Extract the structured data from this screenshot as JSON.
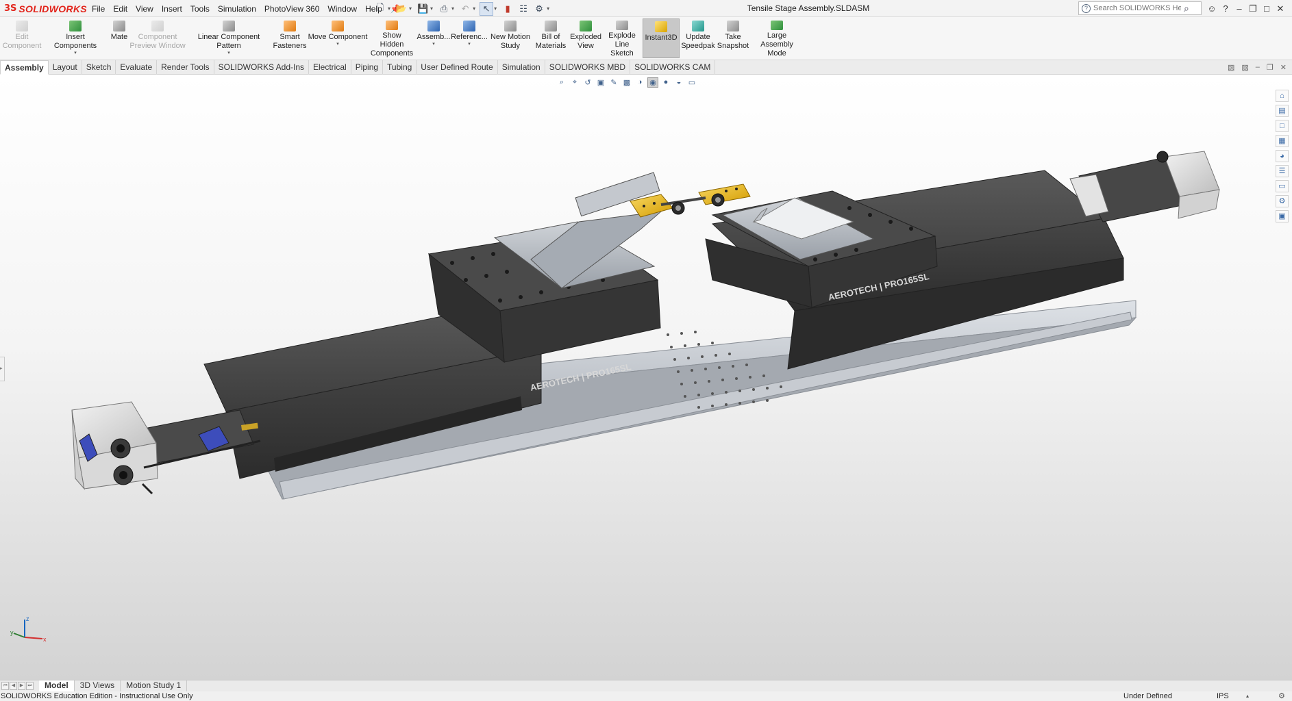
{
  "app": {
    "brand_ds": "3S",
    "brand_name": "SOLIDWORKS",
    "document_title": "Tensile Stage Assembly.SLDASM"
  },
  "menu": {
    "items": [
      "File",
      "Edit",
      "View",
      "Insert",
      "Tools",
      "Simulation",
      "PhotoView 360",
      "Window",
      "Help"
    ]
  },
  "search": {
    "placeholder": "Search SOLIDWORKS Help"
  },
  "ribbon": {
    "edit_component": {
      "line1": "Edit",
      "line2": "Component"
    },
    "insert_components": {
      "line1": "Insert Components"
    },
    "mate": {
      "line1": "Mate"
    },
    "component_preview": {
      "line1": "Component",
      "line2": "Preview Window"
    },
    "linear_pattern": {
      "line1": "Linear Component Pattern"
    },
    "smart_fasteners": {
      "line1": "Smart",
      "line2": "Fasteners"
    },
    "move_component": {
      "line1": "Move Component"
    },
    "show_hidden": {
      "line1": "Show Hidden",
      "line2": "Components"
    },
    "assembly_features": {
      "line1": "Assemb..."
    },
    "reference_geometry": {
      "line1": "Referenc..."
    },
    "new_motion_study": {
      "line1": "New Motion",
      "line2": "Study"
    },
    "bill_of_materials": {
      "line1": "Bill of",
      "line2": "Materials"
    },
    "exploded_view": {
      "line1": "Exploded",
      "line2": "View"
    },
    "explode_line_sketch": {
      "line1": "Explode",
      "line2": "Line Sketch"
    },
    "instant3d": {
      "line1": "Instant3D"
    },
    "update_speedpak": {
      "line1": "Update",
      "line2": "Speedpak"
    },
    "take_snapshot": {
      "line1": "Take",
      "line2": "Snapshot"
    },
    "large_assembly_mode": {
      "line1": "Large Assembly",
      "line2": "Mode"
    }
  },
  "tabs": [
    "Assembly",
    "Layout",
    "Sketch",
    "Evaluate",
    "Render Tools",
    "SOLIDWORKS Add-Ins",
    "Electrical",
    "Piping",
    "Tubing",
    "User Defined Route",
    "Simulation",
    "SOLIDWORKS MBD",
    "SOLIDWORKS CAM"
  ],
  "model": {
    "stage_label_left": "AEROTECH | PRO165SL",
    "stage_label_right": "AEROTECH | PRO165SL"
  },
  "triad": {
    "x": "x",
    "y": "y",
    "z": "z"
  },
  "bottom_tabs": [
    "Model",
    "3D Views",
    "Motion Study 1"
  ],
  "status": {
    "edition": "SOLIDWORKS Education Edition - Instructional Use Only",
    "state": "Under Defined",
    "units": "IPS"
  },
  "colors": {
    "brand_red": "#e2231a",
    "stage_body": "#3f3f3f",
    "base_plate": "#b9bec6",
    "grip_yellow": "#f2c230",
    "motor_housing": "#e6e6e6"
  }
}
